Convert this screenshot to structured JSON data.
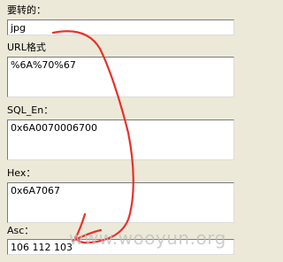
{
  "fields": [
    {
      "label": "要转的：",
      "value": "jpg"
    },
    {
      "label": "URL格式",
      "value": "%6A%70%67"
    },
    {
      "label": "SQL_En：",
      "value": "0x6A0070006700"
    },
    {
      "label": "Hex：",
      "value": "0x6A7067"
    },
    {
      "label": "Asc：",
      "value": "106 112 103"
    }
  ],
  "watermark": "www.wooyun.org",
  "annotation_color": "#e8312a"
}
